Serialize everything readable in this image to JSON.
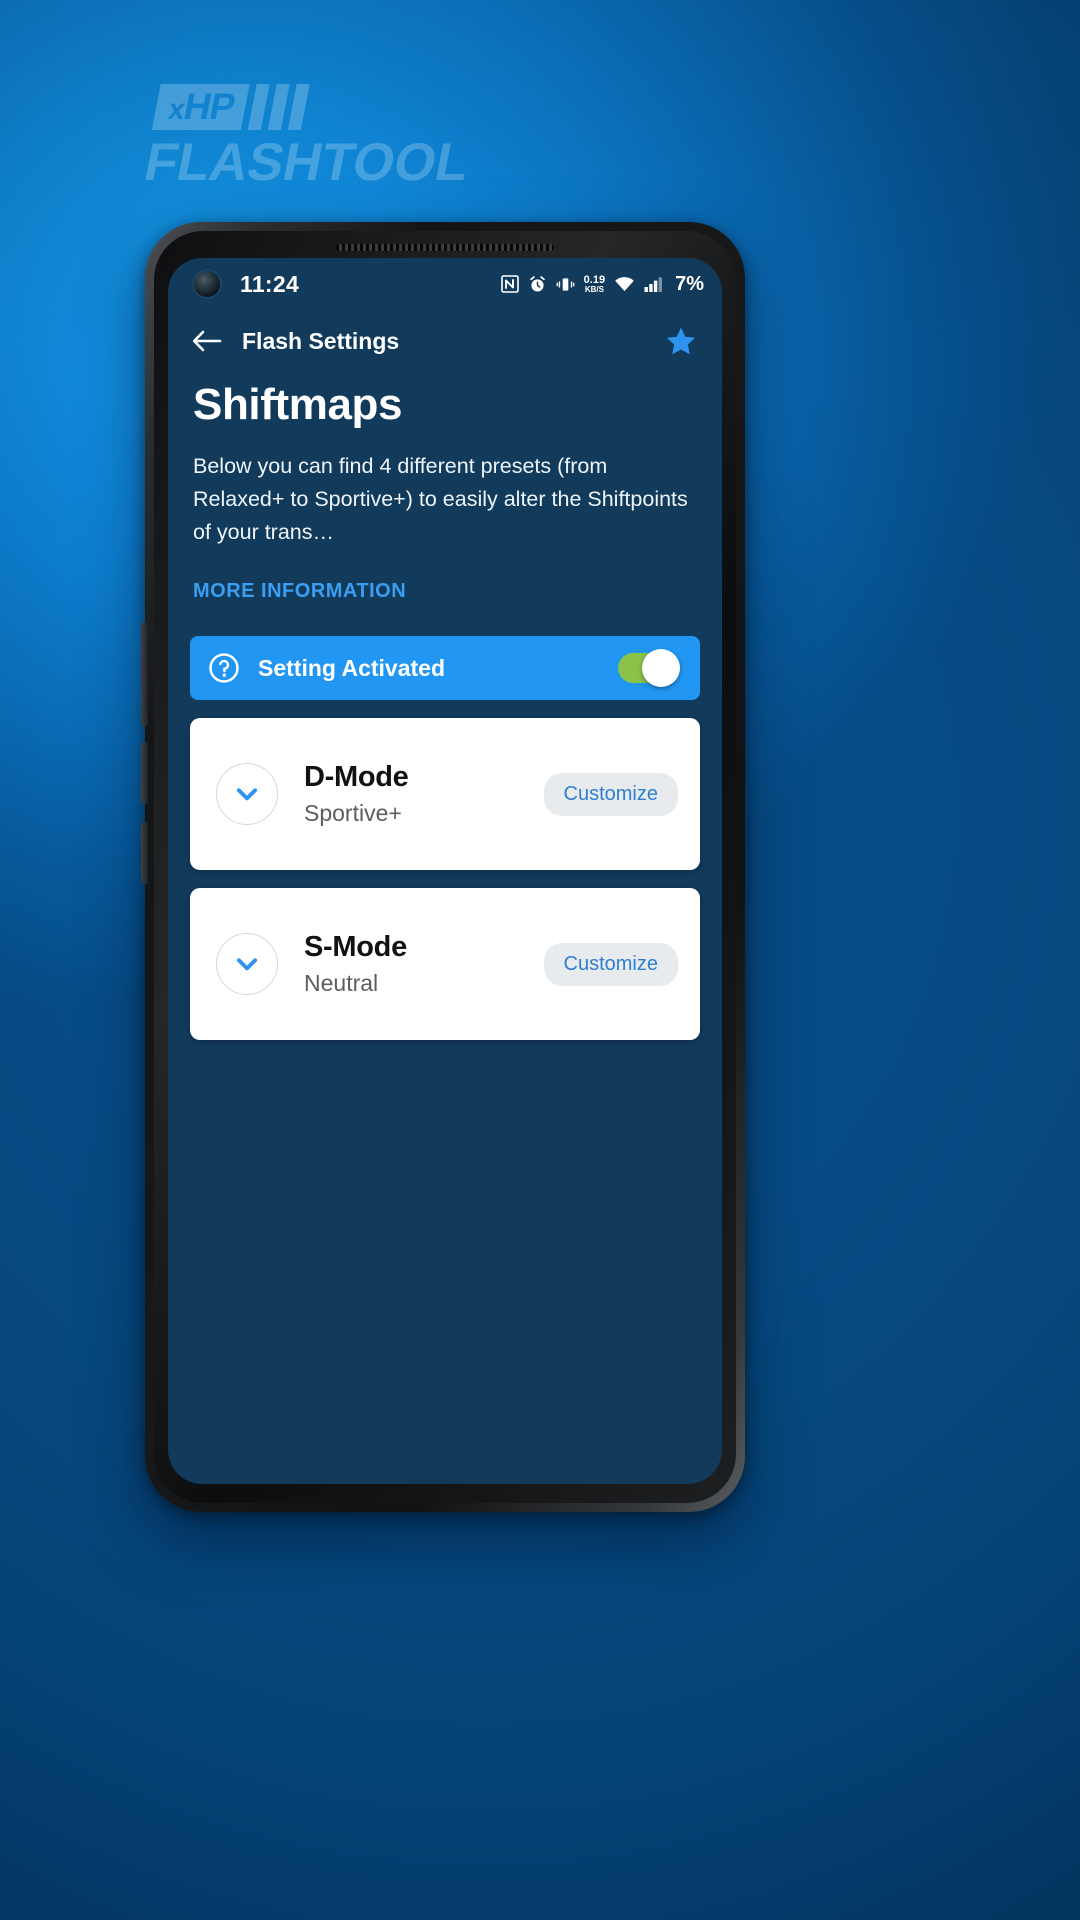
{
  "wallpaper": {
    "brand_logo": {
      "prefix": "x",
      "name": "HP",
      "word": "FLASHTOOL",
      "bars": 3
    }
  },
  "statusbar": {
    "time": "11:24",
    "icons": [
      "nfc-icon",
      "alarm-icon",
      "vibrate-icon",
      "wifi-icon",
      "signal-icon"
    ],
    "net_speed_value": "0.19",
    "net_speed_unit": "KB/S",
    "battery": "7%"
  },
  "appbar": {
    "back_label": "back-arrow",
    "title": "Flash Settings",
    "favorite": "star-icon"
  },
  "main": {
    "title": "Shiftmaps",
    "description": "Below you can find 4 different presets (from Relaxed+ to Sportive+) to easily alter the Shiftpoints of your trans…",
    "more_link": "MORE INFORMATION",
    "banner": {
      "help_icon": "help-circle-icon",
      "label": "Setting Activated",
      "toggle_on": true
    },
    "cards": [
      {
        "expand_icon": "chevron-down-icon",
        "title": "D-Mode",
        "subtitle": "Sportive+",
        "action": "Customize"
      },
      {
        "expand_icon": "chevron-down-icon",
        "title": "S-Mode",
        "subtitle": "Neutral",
        "action": "Customize"
      }
    ]
  },
  "colors": {
    "accent": "#2196F3",
    "screen_bg": "#123A5B",
    "toggle_on": "#8BC34A",
    "link": "#3b9ef2"
  }
}
